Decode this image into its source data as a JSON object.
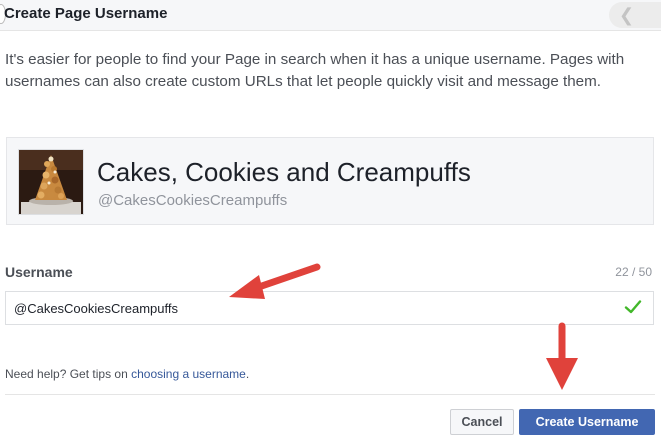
{
  "dialog": {
    "title": "Create Page Username",
    "intro": "It's easier for people to find your Page in search when it has a unique username. Pages with usernames can also create custom URLs that let people quickly visit and message them."
  },
  "page": {
    "name": "Cakes, Cookies and Creampuffs",
    "handle": "@CakesCookiesCreampuffs"
  },
  "username_field": {
    "label": "Username",
    "counter": "22 / 50",
    "value": "@CakesCookiesCreampuffs",
    "valid": true
  },
  "help": {
    "prefix": "Need help? Get tips on ",
    "link_text": "choosing a username",
    "suffix": "."
  },
  "buttons": {
    "cancel": "Cancel",
    "create": "Create Username"
  },
  "colors": {
    "primary": "#4267b2",
    "link": "#365899",
    "check": "#42b72a",
    "annotation_arrow": "#e0423b"
  },
  "icons": {
    "valid": "check-icon",
    "close": "close-icon"
  }
}
